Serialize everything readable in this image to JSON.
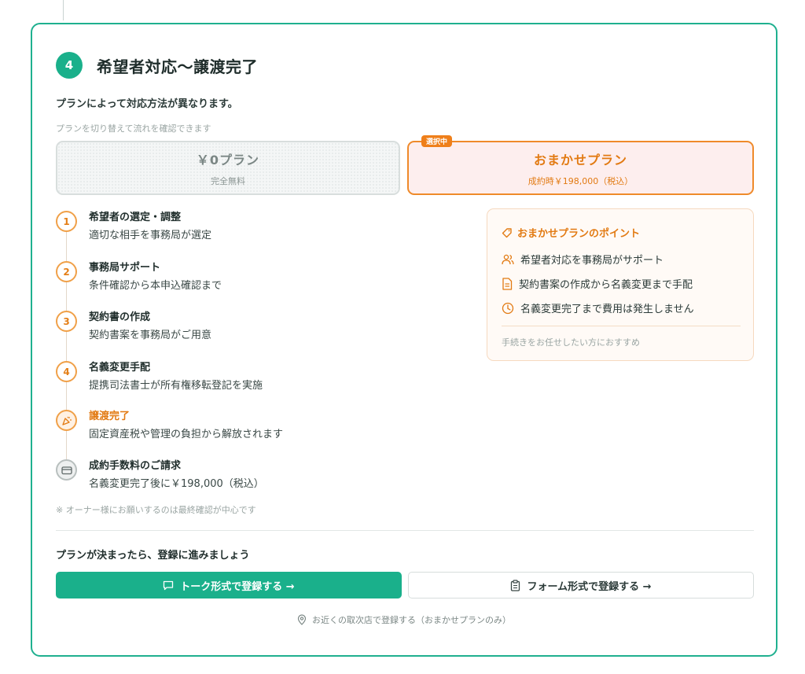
{
  "step": {
    "number": "4",
    "title": "希望者対応〜譲渡完了"
  },
  "subtitle": "プランによって対応方法が異なります。",
  "hint": "プランを切り替えて流れを確認できます",
  "plans": [
    {
      "name": "￥0プラン",
      "desc": "完全無料",
      "selected": false
    },
    {
      "name": "おまかせプラン",
      "desc": "成約時￥198,000（税込）",
      "selected": true,
      "badge": "選択中"
    }
  ],
  "timeline": [
    {
      "marker": "1",
      "title": "希望者の選定・調整",
      "desc": "適切な相手を事務局が選定"
    },
    {
      "marker": "2",
      "title": "事務局サポート",
      "desc": "条件確認から本申込確認まで"
    },
    {
      "marker": "3",
      "title": "契約書の作成",
      "desc": "契約書案を事務局がご用意"
    },
    {
      "marker": "4",
      "title": "名義変更手配",
      "desc": "提携司法書士が所有権移転登記を実施"
    },
    {
      "marker": "party-popper-icon",
      "title": "譲渡完了",
      "desc": "固定資産税や管理の負担から解放されます"
    },
    {
      "marker": "credit-card-icon",
      "title": "成約手数料のご請求",
      "desc": "名義変更完了後に￥198,000（税込）"
    }
  ],
  "points": {
    "title": "おまかせプランのポイント",
    "items": [
      {
        "icon": "users-icon",
        "text": "希望者対応を事務局がサポート"
      },
      {
        "icon": "document-icon",
        "text": "契約書案の作成から名義変更まで手配"
      },
      {
        "icon": "clock-icon",
        "text": "名義変更完了まで費用は発生しません"
      }
    ],
    "note": "手続きをお任せしたい方におすすめ"
  },
  "footnote": "※ オーナー様にお願いするのは最終確認が中心です",
  "register": {
    "heading": "プランが決まったら、登録に進みましょう",
    "talk_button": "トーク形式で登録する →",
    "form_button": "フォーム形式で登録する →",
    "store_link": "お近くの取次店で登録する（おまかせプランのみ）"
  },
  "colors": {
    "brand_green": "#1ab08b",
    "accent_orange": "#e27a12",
    "selected_bg": "#fdeeee"
  }
}
